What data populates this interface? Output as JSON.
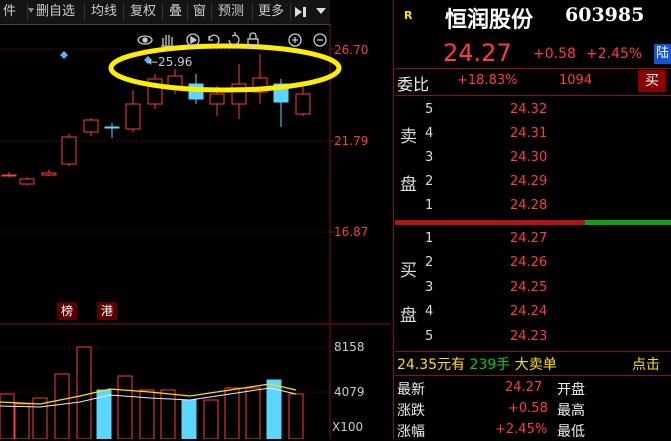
{
  "toolbar": {
    "items": [
      "件",
      "删自选",
      "均线",
      "复权",
      "叠",
      "窗",
      "预测",
      "更多"
    ],
    "icons": [
      "play-forward-icon",
      "chevron-down-icon",
      "chevron-down-icon"
    ]
  },
  "chart": {
    "price_labels": [
      "26.70",
      "21.79",
      "16.87"
    ],
    "annotation": "←25.96",
    "tags": [
      "榜",
      "港"
    ],
    "volume_labels": [
      "8158",
      "4079",
      "X100"
    ],
    "toolbar_icons": [
      "eye-icon",
      "hand-icon",
      "replay-icon",
      "undo-icon",
      "lock-icon",
      "zoom-in-icon",
      "zoom-out-icon"
    ]
  },
  "quote": {
    "badge": "R",
    "name": "恒润股份",
    "code": "603985",
    "price": "24.27",
    "change": "+0.58",
    "change_pct": "+2.45%",
    "exchange_badge": "陆",
    "weibi_label": "委比",
    "weibi_value": "+18.83%",
    "weicha_value": "1094",
    "buy_button": "买"
  },
  "orderbook": {
    "sell_label_1": "卖",
    "sell_label_2": "盘",
    "buy_label_1": "买",
    "buy_label_2": "盘",
    "sell": [
      {
        "level": "5",
        "price": "24.32"
      },
      {
        "level": "4",
        "price": "24.31"
      },
      {
        "level": "3",
        "price": "24.30"
      },
      {
        "level": "2",
        "price": "24.29"
      },
      {
        "level": "1",
        "price": "24.28"
      }
    ],
    "buy": [
      {
        "level": "1",
        "price": "24.27"
      },
      {
        "level": "2",
        "price": "24.26"
      },
      {
        "level": "3",
        "price": "24.25"
      },
      {
        "level": "4",
        "price": "24.24"
      },
      {
        "level": "5",
        "price": "24.23"
      }
    ]
  },
  "ticker": {
    "price": "24.35",
    "unit": "元有",
    "qty": "239手",
    "desc": "大卖单",
    "more": "点击"
  },
  "stats": {
    "latest_label": "最新",
    "latest_value": "24.27",
    "open_label": "开盘",
    "change_label": "涨跌",
    "change_value": "+0.58",
    "high_label": "最高",
    "pct_label": "涨幅",
    "pct_value": "+2.45%",
    "low_label": "最低"
  },
  "colors": {
    "up": "#ff3b3b",
    "down": "#5bd6ff",
    "ma": "#ffe000",
    "background": "#000000"
  }
}
